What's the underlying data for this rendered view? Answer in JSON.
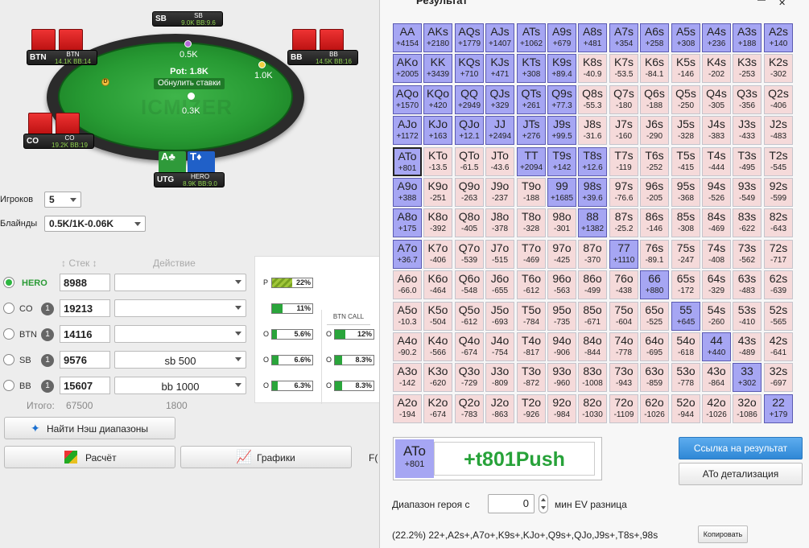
{
  "table": {
    "pot": "Pot: 1.8K",
    "reset": "Обнулить ставки",
    "bets": {
      "top": "0.5K",
      "right": "1.0K",
      "center": "0.3K"
    },
    "watermark": "ICMIZER",
    "dealer": "D",
    "seats": {
      "sb": {
        "pos": "SB",
        "name": "SB",
        "stack": "9.0K BB:9.6"
      },
      "btn": {
        "pos": "BTN",
        "name": "BTN",
        "stack": "14.1K BB:14"
      },
      "bb": {
        "pos": "BB",
        "name": "BB",
        "stack": "14.5K BB:16"
      },
      "co": {
        "pos": "CO",
        "name": "CO",
        "stack": "19.2K BB:19"
      },
      "utg": {
        "pos": "UTG",
        "name": "HERO",
        "stack": "8.9K BB:9.0",
        "cards": [
          "A♣",
          "T♦"
        ]
      }
    }
  },
  "controls": {
    "players_label": "Игроков",
    "players_value": "5",
    "blinds_label": "Блайнды",
    "blinds_value": "0.5K/1K-0.06K",
    "stack_header": "Стек",
    "action_header": "Действие",
    "rows": [
      {
        "name": "HERO",
        "badge": "",
        "stack": "8988",
        "action": ""
      },
      {
        "name": "CO",
        "badge": "1",
        "stack": "19213",
        "action": ""
      },
      {
        "name": "BTN",
        "badge": "1",
        "stack": "14116",
        "action": ""
      },
      {
        "name": "SB",
        "badge": "1",
        "stack": "9576",
        "action": "sb 500"
      },
      {
        "name": "BB",
        "badge": "1",
        "stack": "15607",
        "action": "bb 1000"
      }
    ],
    "total_label": "Итого:",
    "total_stack": "67500",
    "total_action": "1800",
    "nash_button": "Найти Нэш диапазоны",
    "calc_button": "Расчёт",
    "charts_button": "Графики",
    "cut_text": "F("
  },
  "equity": {
    "col1": [
      {
        "prefix": "P",
        "pct": "22%",
        "fill": 0.22,
        "striped": true
      },
      {
        "prefix": "",
        "pct": "11%",
        "fill": 0.11,
        "striped": false
      },
      {
        "prefix": "O",
        "pct": "5.6%",
        "fill": 0.056,
        "striped": false
      },
      {
        "prefix": "O",
        "pct": "6.6%",
        "fill": 0.066,
        "striped": false
      },
      {
        "prefix": "O",
        "pct": "6.3%",
        "fill": 0.063,
        "striped": false
      }
    ],
    "col2_header": "BTN CALL",
    "col2": [
      {
        "prefix": "O",
        "pct": "12%",
        "fill": 0.12
      },
      {
        "prefix": "O",
        "pct": "8.3%",
        "fill": 0.083
      },
      {
        "prefix": "O",
        "pct": "8.3%",
        "fill": 0.083
      }
    ]
  },
  "result": {
    "title": "Результат",
    "push_color": "#a6a6f3",
    "fold_color": "#f5dada",
    "grid": [
      [
        [
          "AA",
          "+4154",
          1
        ],
        [
          "AKs",
          "+2180",
          1
        ],
        [
          "AQs",
          "+1779",
          1
        ],
        [
          "AJs",
          "+1407",
          1
        ],
        [
          "ATs",
          "+1062",
          1
        ],
        [
          "A9s",
          "+679",
          1
        ],
        [
          "A8s",
          "+481",
          1
        ],
        [
          "A7s",
          "+354",
          1
        ],
        [
          "A6s",
          "+258",
          1
        ],
        [
          "A5s",
          "+308",
          1
        ],
        [
          "A4s",
          "+236",
          1
        ],
        [
          "A3s",
          "+188",
          1
        ],
        [
          "A2s",
          "+140",
          1
        ]
      ],
      [
        [
          "AKo",
          "+2005",
          1
        ],
        [
          "KK",
          "+3439",
          1
        ],
        [
          "KQs",
          "+710",
          1
        ],
        [
          "KJs",
          "+471",
          1
        ],
        [
          "KTs",
          "+308",
          1
        ],
        [
          "K9s",
          "+89.4",
          1
        ],
        [
          "K8s",
          "-40.9",
          0
        ],
        [
          "K7s",
          "-53.5",
          0
        ],
        [
          "K6s",
          "-84.1",
          0
        ],
        [
          "K5s",
          "-146",
          0
        ],
        [
          "K4s",
          "-202",
          0
        ],
        [
          "K3s",
          "-253",
          0
        ],
        [
          "K2s",
          "-302",
          0
        ]
      ],
      [
        [
          "AQo",
          "+1570",
          1
        ],
        [
          "KQo",
          "+420",
          1
        ],
        [
          "QQ",
          "+2949",
          1
        ],
        [
          "QJs",
          "+329",
          1
        ],
        [
          "QTs",
          "+261",
          1
        ],
        [
          "Q9s",
          "+77.3",
          1
        ],
        [
          "Q8s",
          "-55.3",
          0
        ],
        [
          "Q7s",
          "-180",
          0
        ],
        [
          "Q6s",
          "-188",
          0
        ],
        [
          "Q5s",
          "-250",
          0
        ],
        [
          "Q4s",
          "-305",
          0
        ],
        [
          "Q3s",
          "-356",
          0
        ],
        [
          "Q2s",
          "-406",
          0
        ]
      ],
      [
        [
          "AJo",
          "+1172",
          1
        ],
        [
          "KJo",
          "+163",
          1
        ],
        [
          "QJo",
          "+12.1",
          1
        ],
        [
          "JJ",
          "+2494",
          1
        ],
        [
          "JTs",
          "+276",
          1
        ],
        [
          "J9s",
          "+99.5",
          1
        ],
        [
          "J8s",
          "-31.6",
          0
        ],
        [
          "J7s",
          "-160",
          0
        ],
        [
          "J6s",
          "-290",
          0
        ],
        [
          "J5s",
          "-328",
          0
        ],
        [
          "J4s",
          "-383",
          0
        ],
        [
          "J3s",
          "-433",
          0
        ],
        [
          "J2s",
          "-483",
          0
        ]
      ],
      [
        [
          "ATo",
          "+801",
          1
        ],
        [
          "KTo",
          "-13.5",
          0
        ],
        [
          "QTo",
          "-61.5",
          0
        ],
        [
          "JTo",
          "-43.6",
          0
        ],
        [
          "TT",
          "+2094",
          1
        ],
        [
          "T9s",
          "+142",
          1
        ],
        [
          "T8s",
          "+12.6",
          1
        ],
        [
          "T7s",
          "-119",
          0
        ],
        [
          "T6s",
          "-252",
          0
        ],
        [
          "T5s",
          "-415",
          0
        ],
        [
          "T4s",
          "-444",
          0
        ],
        [
          "T3s",
          "-495",
          0
        ],
        [
          "T2s",
          "-545",
          0
        ]
      ],
      [
        [
          "A9o",
          "+388",
          1
        ],
        [
          "K9o",
          "-251",
          0
        ],
        [
          "Q9o",
          "-263",
          0
        ],
        [
          "J9o",
          "-237",
          0
        ],
        [
          "T9o",
          "-188",
          0
        ],
        [
          "99",
          "+1685",
          1
        ],
        [
          "98s",
          "+39.6",
          1
        ],
        [
          "97s",
          "-76.6",
          0
        ],
        [
          "96s",
          "-205",
          0
        ],
        [
          "95s",
          "-368",
          0
        ],
        [
          "94s",
          "-526",
          0
        ],
        [
          "93s",
          "-549",
          0
        ],
        [
          "92s",
          "-599",
          0
        ]
      ],
      [
        [
          "A8o",
          "+175",
          1
        ],
        [
          "K8o",
          "-392",
          0
        ],
        [
          "Q8o",
          "-405",
          0
        ],
        [
          "J8o",
          "-378",
          0
        ],
        [
          "T8o",
          "-328",
          0
        ],
        [
          "98o",
          "-301",
          0
        ],
        [
          "88",
          "+1382",
          1
        ],
        [
          "87s",
          "-25.2",
          0
        ],
        [
          "86s",
          "-146",
          0
        ],
        [
          "85s",
          "-308",
          0
        ],
        [
          "84s",
          "-469",
          0
        ],
        [
          "83s",
          "-622",
          0
        ],
        [
          "82s",
          "-643",
          0
        ]
      ],
      [
        [
          "A7o",
          "+36.7",
          1
        ],
        [
          "K7o",
          "-406",
          0
        ],
        [
          "Q7o",
          "-539",
          0
        ],
        [
          "J7o",
          "-515",
          0
        ],
        [
          "T7o",
          "-469",
          0
        ],
        [
          "97o",
          "-425",
          0
        ],
        [
          "87o",
          "-370",
          0
        ],
        [
          "77",
          "+1110",
          1
        ],
        [
          "76s",
          "-89.1",
          0
        ],
        [
          "75s",
          "-247",
          0
        ],
        [
          "74s",
          "-408",
          0
        ],
        [
          "73s",
          "-562",
          0
        ],
        [
          "72s",
          "-717",
          0
        ]
      ],
      [
        [
          "A6o",
          "-66.0",
          0
        ],
        [
          "K6o",
          "-464",
          0
        ],
        [
          "Q6o",
          "-548",
          0
        ],
        [
          "J6o",
          "-655",
          0
        ],
        [
          "T6o",
          "-612",
          0
        ],
        [
          "96o",
          "-563",
          0
        ],
        [
          "86o",
          "-499",
          0
        ],
        [
          "76o",
          "-438",
          0
        ],
        [
          "66",
          "+880",
          1
        ],
        [
          "65s",
          "-172",
          0
        ],
        [
          "64s",
          "-329",
          0
        ],
        [
          "63s",
          "-483",
          0
        ],
        [
          "62s",
          "-639",
          0
        ]
      ],
      [
        [
          "A5o",
          "-10.3",
          0
        ],
        [
          "K5o",
          "-504",
          0
        ],
        [
          "Q5o",
          "-612",
          0
        ],
        [
          "J5o",
          "-693",
          0
        ],
        [
          "T5o",
          "-784",
          0
        ],
        [
          "95o",
          "-735",
          0
        ],
        [
          "85o",
          "-671",
          0
        ],
        [
          "75o",
          "-604",
          0
        ],
        [
          "65o",
          "-525",
          0
        ],
        [
          "55",
          "+645",
          1
        ],
        [
          "54s",
          "-260",
          0
        ],
        [
          "53s",
          "-410",
          0
        ],
        [
          "52s",
          "-565",
          0
        ]
      ],
      [
        [
          "A4o",
          "-90.2",
          0
        ],
        [
          "K4o",
          "-566",
          0
        ],
        [
          "Q4o",
          "-674",
          0
        ],
        [
          "J4o",
          "-754",
          0
        ],
        [
          "T4o",
          "-817",
          0
        ],
        [
          "94o",
          "-906",
          0
        ],
        [
          "84o",
          "-844",
          0
        ],
        [
          "74o",
          "-778",
          0
        ],
        [
          "64o",
          "-695",
          0
        ],
        [
          "54o",
          "-618",
          0
        ],
        [
          "44",
          "+440",
          1
        ],
        [
          "43s",
          "-489",
          0
        ],
        [
          "42s",
          "-641",
          0
        ]
      ],
      [
        [
          "A3o",
          "-142",
          0
        ],
        [
          "K3o",
          "-620",
          0
        ],
        [
          "Q3o",
          "-729",
          0
        ],
        [
          "J3o",
          "-809",
          0
        ],
        [
          "T3o",
          "-872",
          0
        ],
        [
          "93o",
          "-960",
          0
        ],
        [
          "83o",
          "-1008",
          0
        ],
        [
          "73o",
          "-943",
          0
        ],
        [
          "63o",
          "-859",
          0
        ],
        [
          "53o",
          "-778",
          0
        ],
        [
          "43o",
          "-864",
          0
        ],
        [
          "33",
          "+302",
          1
        ],
        [
          "32s",
          "-697",
          0
        ]
      ],
      [
        [
          "A2o",
          "-194",
          0
        ],
        [
          "K2o",
          "-674",
          0
        ],
        [
          "Q2o",
          "-783",
          0
        ],
        [
          "J2o",
          "-863",
          0
        ],
        [
          "T2o",
          "-926",
          0
        ],
        [
          "92o",
          "-984",
          0
        ],
        [
          "82o",
          "-1030",
          0
        ],
        [
          "72o",
          "-1109",
          0
        ],
        [
          "62o",
          "-1026",
          0
        ],
        [
          "52o",
          "-944",
          0
        ],
        [
          "42o",
          "-1026",
          0
        ],
        [
          "32o",
          "-1086",
          0
        ],
        [
          "22",
          "+179",
          1
        ]
      ]
    ],
    "selected": {
      "hand": "ATo",
      "value": "+801",
      "result": "+t801Push"
    },
    "link_button": "Ссылка на результат",
    "detail_button": "ATo детализация",
    "hero_range_label": "Диапазон героя с",
    "ev_value": "0",
    "ev_label": "мин EV разница",
    "range_string": "(22.2%) 22+,A2s+,A7o+,K9s+,KJo+,Q9s+,QJo,J9s+,T8s+,98s",
    "copy_button": "Копировать"
  }
}
